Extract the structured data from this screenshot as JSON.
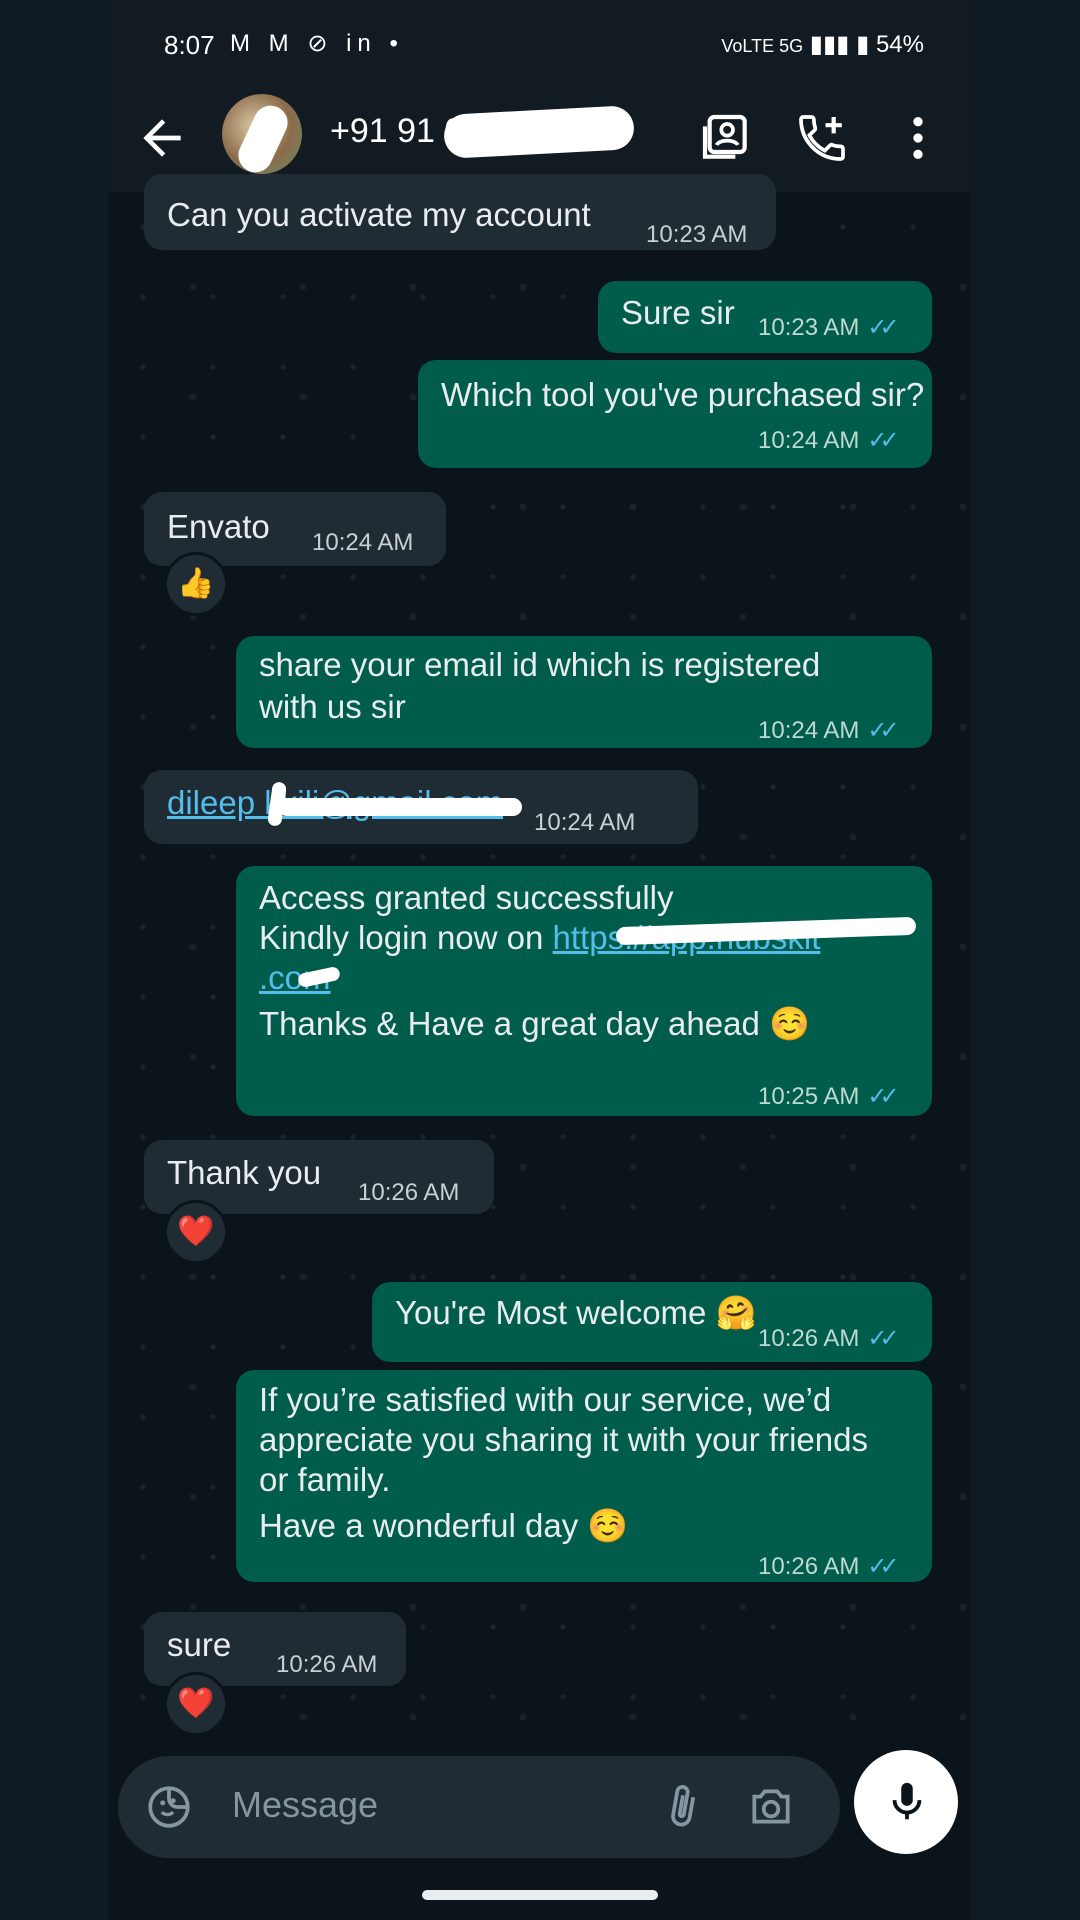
{
  "status_bar": {
    "time": "8:07",
    "left_icons": "M M ⊘ in •",
    "network": "VoLTE 5G",
    "battery": "54%"
  },
  "header": {
    "contact": "+91 91            0"
  },
  "messages": [
    {
      "dir": "in",
      "text": "Can you activate my account",
      "time": "10:23 AM"
    },
    {
      "dir": "out",
      "text": "Sure sir",
      "time": "10:23 AM"
    },
    {
      "dir": "out",
      "text": "Which tool you've purchased sir?",
      "time": "10:24 AM"
    },
    {
      "dir": "in",
      "text": "Envato",
      "time": "10:24 AM",
      "reaction": "👍"
    },
    {
      "dir": "out",
      "lines": [
        "share your email id which is registered",
        "with us sir"
      ],
      "time": "10:24 AM"
    },
    {
      "dir": "in",
      "text": "dileep kkili@gmail.com",
      "time": "10:24 AM"
    },
    {
      "dir": "out",
      "lines": [
        "Access granted successfully",
        "Kindly login now on",
        "https://app.hubskit",
        ".com",
        "Thanks & Have a great day ahead ☺️"
      ],
      "time": "10:25 AM"
    },
    {
      "dir": "in",
      "text": "Thank you",
      "time": "10:26 AM",
      "reaction": "❤️"
    },
    {
      "dir": "out",
      "text": "You're Most welcome 🤗",
      "time": "10:26 AM"
    },
    {
      "dir": "out",
      "lines": [
        "If you’re satisfied with our service, we’d",
        "appreciate you sharing it with your friends",
        "or family.",
        "Have a wonderful day ☺️"
      ],
      "time": "10:26 AM"
    },
    {
      "dir": "in",
      "text": "sure",
      "time": "10:26 AM",
      "reaction": "❤️"
    }
  ],
  "composer": {
    "placeholder": "Message"
  },
  "colors": {
    "incoming": "#202c33",
    "outgoing": "#005c4b",
    "tick": "#53bdeb",
    "link": "#53bdeb",
    "background": "#0b141a"
  },
  "icons": [
    "back-arrow-icon",
    "contact-card-icon",
    "add-call-icon",
    "more-vert-icon",
    "sticker-icon",
    "attach-icon",
    "camera-icon",
    "mic-icon"
  ]
}
